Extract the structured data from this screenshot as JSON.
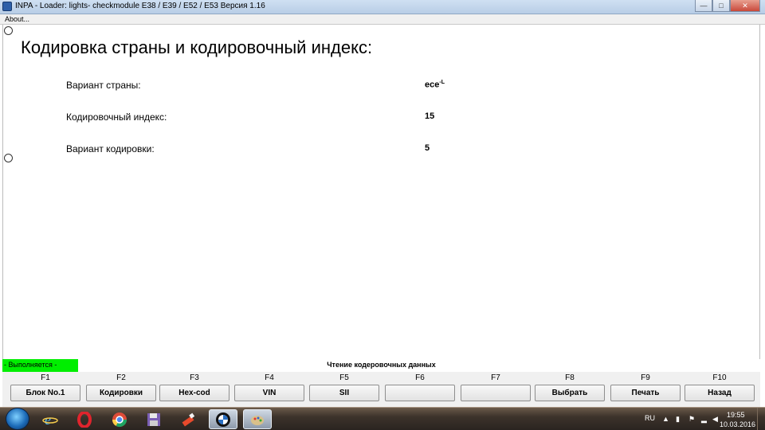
{
  "window": {
    "title": "INPA - Loader:  lights- checkmodule E38 / E39 / E52 / E53 Версия 1.16",
    "minimize": "—",
    "maximize": "□",
    "close": "✕"
  },
  "menu": {
    "about": "About..."
  },
  "content": {
    "heading": "Кодировка страны и кодировочный индекс:",
    "rows": [
      {
        "label": "Вариант страны:",
        "value": "ece-L"
      },
      {
        "label": "Кодировочный индекс:",
        "value": "15"
      },
      {
        "label": "Вариант кодировки:",
        "value": "5"
      }
    ]
  },
  "status": {
    "running": "- Выполняется -",
    "running_color": "#00ee00",
    "message": "Чтение кодеровочных данных"
  },
  "fkeys": [
    {
      "key": "F1",
      "label": "Блок No.1"
    },
    {
      "key": "F2",
      "label": "Кодировки"
    },
    {
      "key": "F3",
      "label": "Hex-cod"
    },
    {
      "key": "F4",
      "label": "VIN"
    },
    {
      "key": "F5",
      "label": "SII"
    },
    {
      "key": "F6",
      "label": ""
    },
    {
      "key": "F7",
      "label": ""
    },
    {
      "key": "F8",
      "label": "Выбрать"
    },
    {
      "key": "F9",
      "label": "Печать"
    },
    {
      "key": "F10",
      "label": "Назад"
    }
  ],
  "taskbar": {
    "items": [
      "internet-explorer-icon",
      "opera-icon",
      "chrome-icon",
      "floppy-save-icon",
      "paint-tool-icon",
      "bmw-icon",
      "inpa-palette-icon"
    ],
    "language": "RU",
    "time": "19:55",
    "date": "10.03.2016"
  }
}
